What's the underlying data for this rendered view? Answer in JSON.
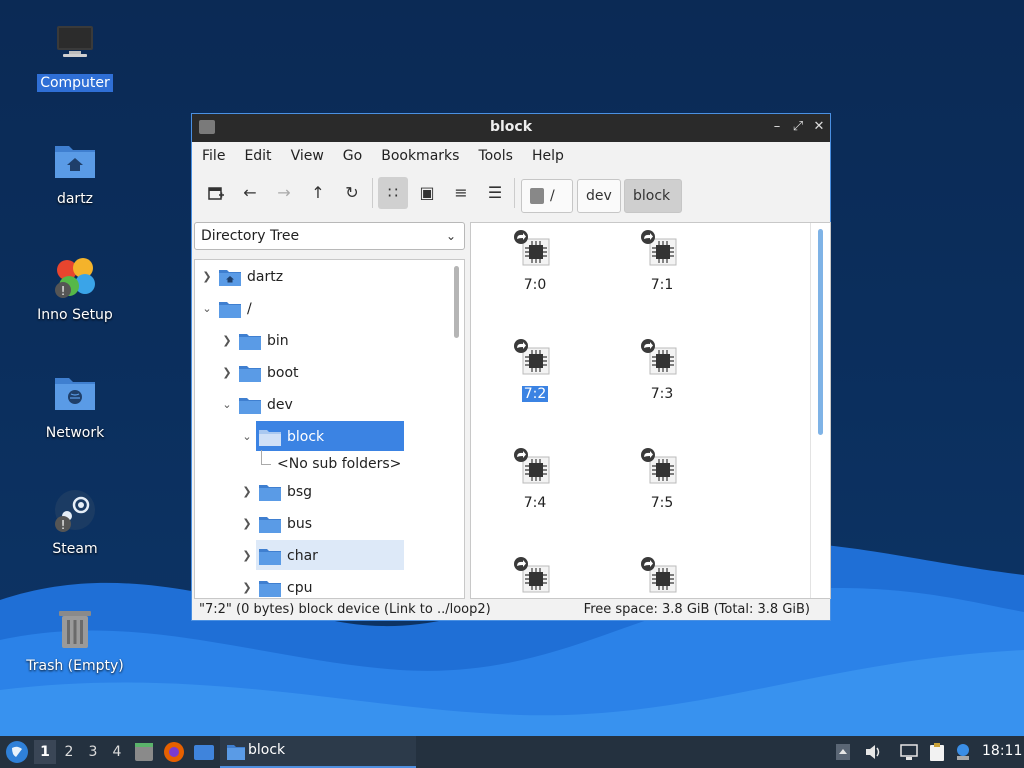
{
  "desktop": {
    "icons": [
      {
        "label": "Computer",
        "selected": true
      },
      {
        "label": "dartz"
      },
      {
        "label": "Inno Setup"
      },
      {
        "label": "Network"
      },
      {
        "label": "Steam"
      },
      {
        "label": "Trash (Empty)"
      }
    ]
  },
  "window": {
    "title": "block",
    "buttons": {
      "minimize": "–",
      "maximize": "⤢",
      "close": "✕"
    },
    "menu": [
      "File",
      "Edit",
      "View",
      "Go",
      "Bookmarks",
      "Tools",
      "Help"
    ],
    "toolbar": {
      "new_window_icon": "new-tab-icon",
      "back": "←",
      "forward": "→",
      "up": "↑",
      "reload": "↻",
      "icon_view": "∷",
      "thumbnail_view": "▣",
      "compact_view": "≡",
      "detailed_view": "☰"
    },
    "path": [
      {
        "label": "/"
      },
      {
        "label": "dev"
      },
      {
        "label": "block",
        "current": true
      }
    ],
    "side_pane": {
      "mode": "Directory Tree",
      "tree": [
        {
          "label": "dartz",
          "expanded": false
        },
        {
          "label": "/",
          "expanded": true
        },
        {
          "label": "bin",
          "expanded": false
        },
        {
          "label": "boot",
          "expanded": false
        },
        {
          "label": "dev",
          "expanded": true
        },
        {
          "label": "block",
          "expanded": true,
          "selected": true
        },
        {
          "label": "<No sub folders>"
        },
        {
          "label": "bsg",
          "expanded": false
        },
        {
          "label": "bus",
          "expanded": false
        },
        {
          "label": "char",
          "expanded": false,
          "hover": true
        },
        {
          "label": "cpu",
          "expanded": false
        }
      ]
    },
    "files": [
      {
        "name": "7:0",
        "icon": "block-device-icon"
      },
      {
        "name": "7:1",
        "icon": "block-device-icon"
      },
      {
        "name": "7:2",
        "icon": "block-device-icon",
        "selected": true
      },
      {
        "name": "7:3",
        "icon": "block-device-icon"
      },
      {
        "name": "7:4",
        "icon": "block-device-icon"
      },
      {
        "name": "7:5",
        "icon": "block-device-icon"
      },
      {
        "name": "",
        "icon": "block-device-icon"
      },
      {
        "name": "",
        "icon": "block-device-icon"
      }
    ],
    "status": {
      "left": "\"7:2\" (0 bytes) block device (Link to ../loop2)",
      "right": "Free space: 3.8 GiB (Total: 3.8 GiB)"
    }
  },
  "taskbar": {
    "workspaces": [
      "1",
      "2",
      "3",
      "4"
    ],
    "current_workspace": "1",
    "task": {
      "label": "block"
    },
    "clock": "18:11"
  },
  "colors": {
    "accent": "#3b83e3",
    "titlebar": "#2a2a2a",
    "taskbar": "#24313f",
    "folder": "#4a8fe0"
  }
}
